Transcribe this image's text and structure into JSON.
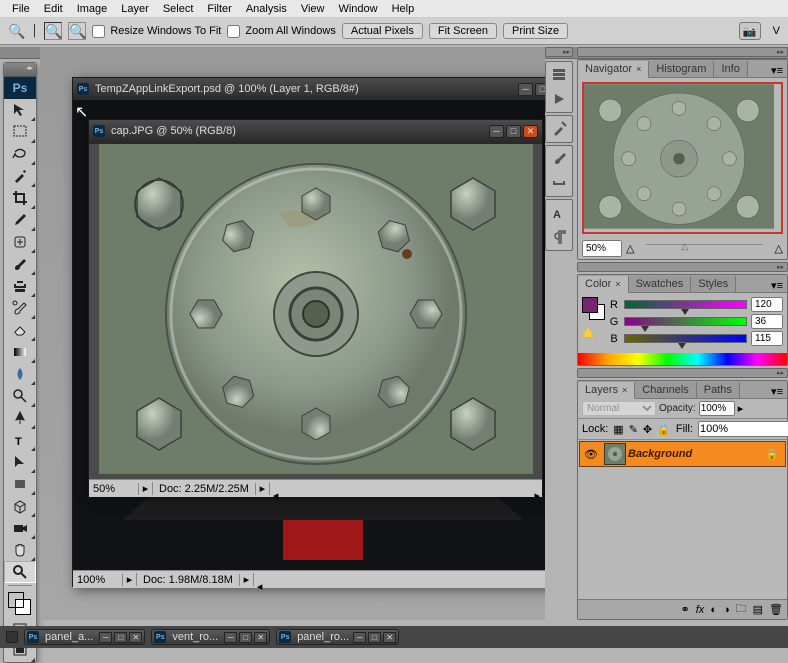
{
  "menu": {
    "items": [
      "File",
      "Edit",
      "Image",
      "Layer",
      "Select",
      "Filter",
      "Analysis",
      "View",
      "Window",
      "Help"
    ]
  },
  "options": {
    "resize_label": "Resize Windows To Fit",
    "zoom_all_label": "Zoom All Windows",
    "actual_pixels": "Actual Pixels",
    "fit_screen": "Fit Screen",
    "print_size": "Print Size"
  },
  "taskbar_docs": [
    {
      "label": "panel_a..."
    },
    {
      "label": "vent_ro..."
    },
    {
      "label": "panel_ro..."
    }
  ],
  "doc1": {
    "title": "TempZAppLinkExport.psd @ 100% (Layer 1, RGB/8#)",
    "zoom": "100%",
    "docsize": "Doc: 1.98M/8.18M"
  },
  "doc2": {
    "title": "cap.JPG @ 50% (RGB/8)",
    "zoom": "50%",
    "docsize": "Doc: 2.25M/2.25M"
  },
  "nav_panel": {
    "tabs": [
      "Navigator",
      "Histogram",
      "Info"
    ],
    "zoom": "50%"
  },
  "color_panel": {
    "tabs": [
      "Color",
      "Swatches",
      "Styles"
    ],
    "r_label": "R",
    "g_label": "G",
    "b_label": "B",
    "r": "120",
    "g": "36",
    "b": "115",
    "fg_hex": "#782473"
  },
  "layers_panel": {
    "tabs": [
      "Layers",
      "Channels",
      "Paths"
    ],
    "blend_mode": "Normal",
    "opacity_label": "Opacity:",
    "opacity_value": "100%",
    "lock_label": "Lock:",
    "fill_label": "Fill:",
    "fill_value": "100%",
    "bg_layer": "Background"
  },
  "fg_color": "#782473"
}
